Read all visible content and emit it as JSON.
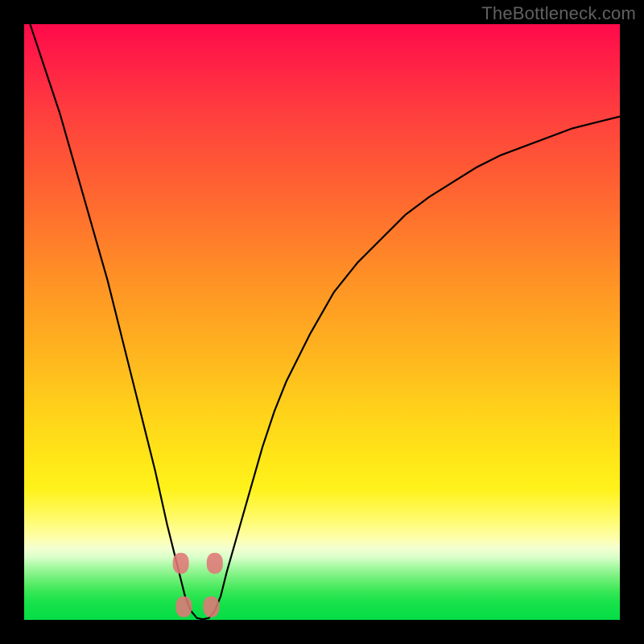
{
  "watermark": "TheBottleneck.com",
  "colors": {
    "background": "#000000",
    "curve": "#000000",
    "marker": "#e07878",
    "gradient_top": "#ff0a4a",
    "gradient_bottom": "#05dd46"
  },
  "chart_data": {
    "type": "line",
    "title": "",
    "xlabel": "",
    "ylabel": "",
    "xlim": [
      0,
      100
    ],
    "ylim": [
      0,
      100
    ],
    "x": [
      0,
      2,
      4,
      6,
      8,
      10,
      12,
      14,
      16,
      18,
      20,
      22,
      24,
      25,
      26,
      27,
      28,
      29,
      30,
      31,
      32,
      33,
      34,
      36,
      38,
      40,
      42,
      44,
      48,
      52,
      56,
      60,
      64,
      68,
      72,
      76,
      80,
      84,
      88,
      92,
      96,
      100
    ],
    "y": [
      103,
      97,
      91,
      85,
      78,
      71,
      64,
      57,
      49,
      41,
      33,
      25,
      16,
      12,
      8,
      4,
      1.5,
      0.3,
      0.1,
      0.3,
      1.5,
      4,
      8,
      15,
      22,
      29,
      35,
      40,
      48,
      55,
      60,
      64,
      68,
      71,
      73.5,
      76,
      78,
      79.5,
      81,
      82.5,
      83.5,
      84.5
    ],
    "minimum_x": 29,
    "markers": [
      {
        "x": 26.3,
        "y": 9.5
      },
      {
        "x": 32.0,
        "y": 9.5
      },
      {
        "x": 26.8,
        "y": 2.2
      },
      {
        "x": 31.4,
        "y": 2.2
      }
    ],
    "legend": null,
    "grid": false
  }
}
